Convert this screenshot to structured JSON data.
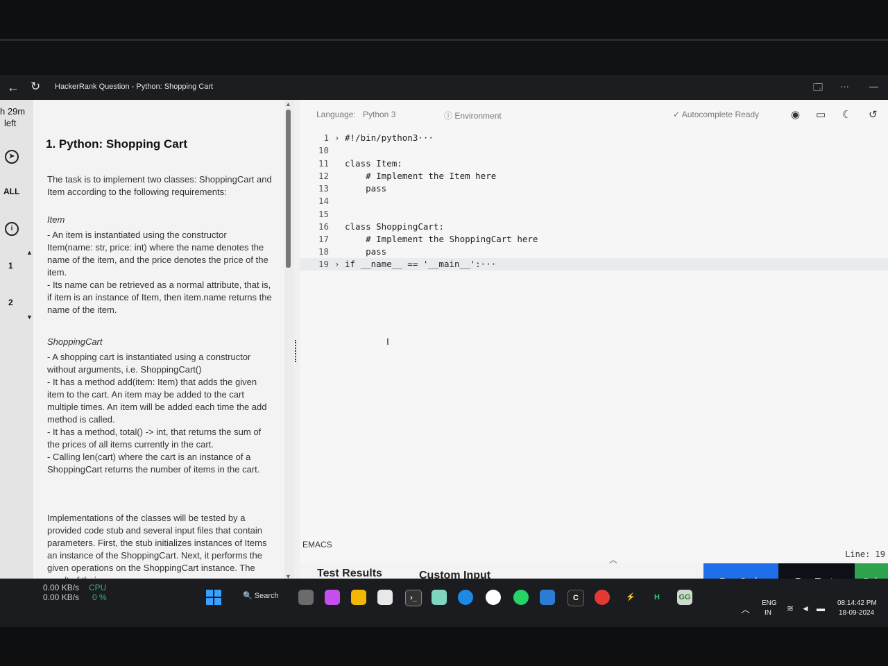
{
  "window": {
    "title": "HackerRank Question - Python: Shopping Cart",
    "back_icon": "←",
    "reload_icon": "↻",
    "right_icons": [
      "🗔",
      "···",
      "—"
    ]
  },
  "sidebar": {
    "time_line1": "h 29m",
    "time_line2": "left",
    "filter_all": "ALL",
    "question_1": "1",
    "question_2": "2"
  },
  "problem": {
    "title": "1. Python: Shopping Cart",
    "intro": "The task is to implement two classes: ShoppingCart and Item according to the following requirements:",
    "item_heading": "Item",
    "item_p1": "- An item is instantiated using the constructor Item(name: str, price: int) where the name denotes the name of the item, and the price denotes the price of the item.",
    "item_p2": "- Its name can be retrieved as a normal attribute, that is, if item is an instance of Item, then item.name returns the name of the item.",
    "cart_heading": "ShoppingCart",
    "cart_p1": "- A shopping cart is instantiated using a constructor without arguments, i.e. ShoppingCart()",
    "cart_p2": "- It has a method add(item: Item) that adds the given item to the cart. An item may be added to the cart multiple times. An item will be added each time the add method is called.",
    "cart_p3": "- It has a method, total() -> int, that returns the sum of the prices of all items currently in the cart.",
    "cart_p4": "- Calling len(cart) where the cart is an instance of a ShoppingCart returns the number of items in the cart.",
    "impl": "Implementations of the classes will be tested by a provided code stub and several input files that contain parameters. First, the stub initializes instances of Items an instance of the ShoppingCart. Next, it performs the given operations on the ShoppingCart instance. The result of their"
  },
  "editor": {
    "language_label": "Language:",
    "language_value": "Python 3",
    "environment": "ⓘ Environment",
    "autocomplete": "✓ Autocomplete Ready",
    "mode": "EMACS",
    "line_status": "Line: 19",
    "lines": [
      {
        "num": "1",
        "fold": "›",
        "text": "#!/bin/python3···"
      },
      {
        "num": "10",
        "fold": "",
        "text": ""
      },
      {
        "num": "11",
        "fold": "",
        "text": "class Item:"
      },
      {
        "num": "12",
        "fold": "",
        "text": "    # Implement the Item here"
      },
      {
        "num": "13",
        "fold": "",
        "text": "    pass"
      },
      {
        "num": "14",
        "fold": "",
        "text": ""
      },
      {
        "num": "15",
        "fold": "",
        "text": ""
      },
      {
        "num": "16",
        "fold": "",
        "text": "class ShoppingCart:"
      },
      {
        "num": "17",
        "fold": "",
        "text": "    # Implement the ShoppingCart here"
      },
      {
        "num": "18",
        "fold": "",
        "text": "    pass"
      },
      {
        "num": "19",
        "fold": "›",
        "text": "if __name__ == '__main__':···"
      }
    ]
  },
  "bottom": {
    "tab_results": "Test Results",
    "tab_custom": "Custom Input",
    "run_code": "Run Code",
    "run_tests": "Run Tests",
    "submit": "Sub"
  },
  "taskbar": {
    "net_up": "0.00 KB/s",
    "net_down": "0.00 KB/s",
    "cpu_label": "CPU",
    "cpu_value": "0 %",
    "search": "Search",
    "lang1": "ENG",
    "lang2": "IN",
    "time": "08:14:42 PM",
    "date": "18-09-2024"
  }
}
